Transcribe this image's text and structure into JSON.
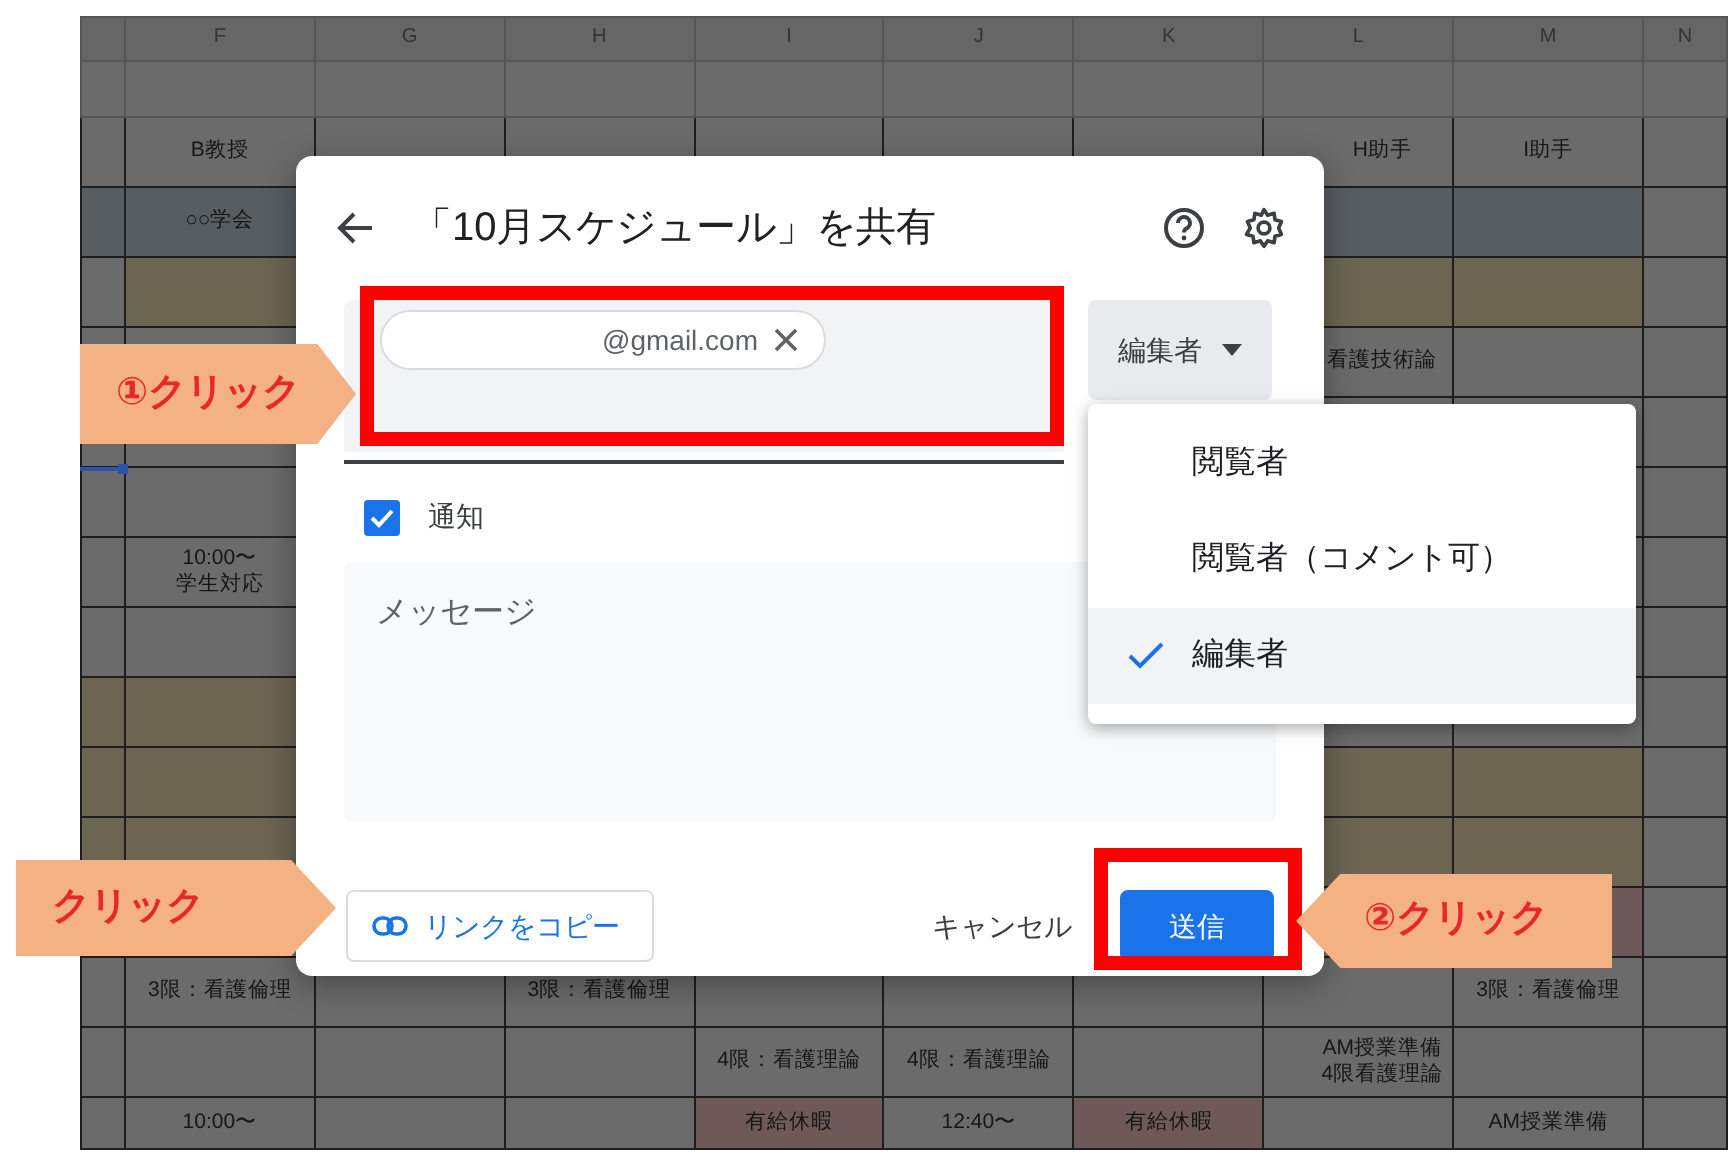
{
  "sheet": {
    "rows": [
      {
        "kind": "header",
        "cells": [
          {},
          {
            "text": "F"
          },
          {
            "text": "G"
          },
          {
            "text": "H"
          },
          {
            "text": "I"
          },
          {
            "text": "J"
          },
          {
            "text": "K"
          },
          {
            "text": "L"
          },
          {
            "text": "M"
          },
          {
            "text": "N"
          }
        ]
      },
      {
        "cells": []
      },
      {
        "cells": [
          {},
          {
            "text": "B教授"
          },
          {},
          {},
          {},
          {},
          {},
          {
            "text": "H助手"
          },
          {
            "text": "I助手"
          }
        ]
      },
      {
        "cells": [
          {
            "color": "#585d61"
          },
          {
            "text": "○○学会",
            "color": "#585d61"
          },
          {},
          {},
          {},
          {},
          {},
          {
            "color": "#585d61"
          },
          {
            "color": "#585d61"
          }
        ]
      },
      {
        "cells": [
          {},
          {
            "color": "#6b6552"
          },
          {},
          {},
          {},
          {},
          {},
          {
            "color": "#6b6552"
          },
          {
            "color": "#6b6552"
          }
        ]
      },
      {
        "cells": [
          {},
          {},
          {},
          {},
          {},
          {},
          {},
          {
            "text": "看護技術論"
          }
        ]
      },
      {
        "cells": []
      },
      {
        "cells": []
      },
      {
        "cells": [
          {},
          {
            "lines": [
              "10:00〜",
              "学生対応"
            ]
          }
        ]
      },
      {
        "cells": []
      },
      {
        "cells": [
          {
            "color": "#6b6552"
          },
          {
            "color": "#6b6552"
          }
        ]
      },
      {
        "cells": [
          {
            "color": "#6b6552"
          },
          {
            "color": "#6b6552"
          },
          {},
          {},
          {},
          {},
          {},
          {
            "color": "#6b6552"
          },
          {
            "color": "#6b6552"
          }
        ]
      },
      {
        "cells": [
          {
            "color": "#6b6552"
          },
          {
            "color": "#6b6552"
          },
          {},
          {},
          {},
          {},
          {},
          {
            "color": "#6b6552"
          },
          {
            "color": "#6b6552"
          }
        ]
      },
      {
        "cells": [
          {},
          {},
          {},
          {},
          {},
          {},
          {},
          {},
          {
            "color": "#6e5858"
          }
        ]
      },
      {
        "cells": [
          {},
          {
            "text": "3限：看護倫理"
          },
          {},
          {
            "text": "3限：看護倫理"
          },
          {},
          {},
          {},
          {},
          {
            "text": "3限：看護倫理"
          }
        ]
      },
      {
        "cells": [
          {},
          {},
          {},
          {},
          {
            "text": "4限：看護理論"
          },
          {
            "text": "4限：看護理論"
          },
          {},
          {
            "lines": [
              "AM授業準備",
              "4限看護理論"
            ]
          }
        ]
      },
      {
        "cells": [
          {},
          {
            "text": "10:00〜"
          },
          {},
          {},
          {
            "text": "有給休暇",
            "color": "#6e5858"
          },
          {
            "text": "12:40〜"
          },
          {
            "text": "有給休暇",
            "color": "#6e5858"
          },
          {},
          {
            "text": "AM授業準備"
          }
        ]
      }
    ]
  },
  "dialog": {
    "title": "「10月スケジュール」を共有",
    "recipient_chip": "@gmail.com",
    "role_button": "編集者",
    "notify": {
      "label": "通知",
      "checked": true
    },
    "message": {
      "placeholder": "メッセージ"
    },
    "copy_link_button": "リンクをコピー",
    "cancel_button": "キャンセル",
    "send_button": "送信"
  },
  "role_menu": [
    {
      "label": "閲覧者",
      "selected": false
    },
    {
      "label": "閲覧者（コメント可）",
      "selected": false
    },
    {
      "label": "編集者",
      "selected": true
    }
  ],
  "callouts": [
    {
      "text": "①クリック",
      "kind": "rightward"
    },
    {
      "text": "クリック",
      "kind": "rightward"
    },
    {
      "text": "②クリック",
      "kind": "leftward"
    }
  ]
}
